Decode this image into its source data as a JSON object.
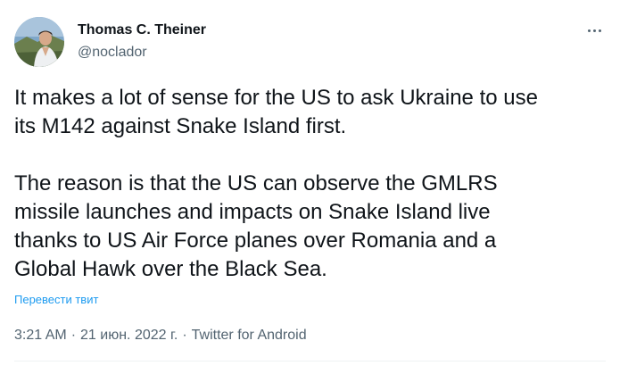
{
  "author": {
    "name": "Thomas C. Theiner",
    "handle": "@noclador"
  },
  "tweet": {
    "paragraphs": [
      "It makes a lot of sense for the US to ask Ukraine to use\nits M142 against Snake Island first.",
      "The reason is that the US can observe the GMLRS\nmissile launches and impacts on Snake Island live\nthanks to US Air Force planes over Romania and a\nGlobal Hawk over the Black Sea."
    ],
    "translate_label": "Перевести твит",
    "time": "3:21 AM",
    "date": "21 июн. 2022 г.",
    "source": "Twitter for Android",
    "separator": "·"
  },
  "icons": {
    "more": "more-horizontal-icon",
    "avatar": "profile-photo"
  },
  "colors": {
    "text_primary": "#0f1419",
    "text_secondary": "#536471",
    "link": "#1d9bf0",
    "divider": "#eff3f4"
  }
}
